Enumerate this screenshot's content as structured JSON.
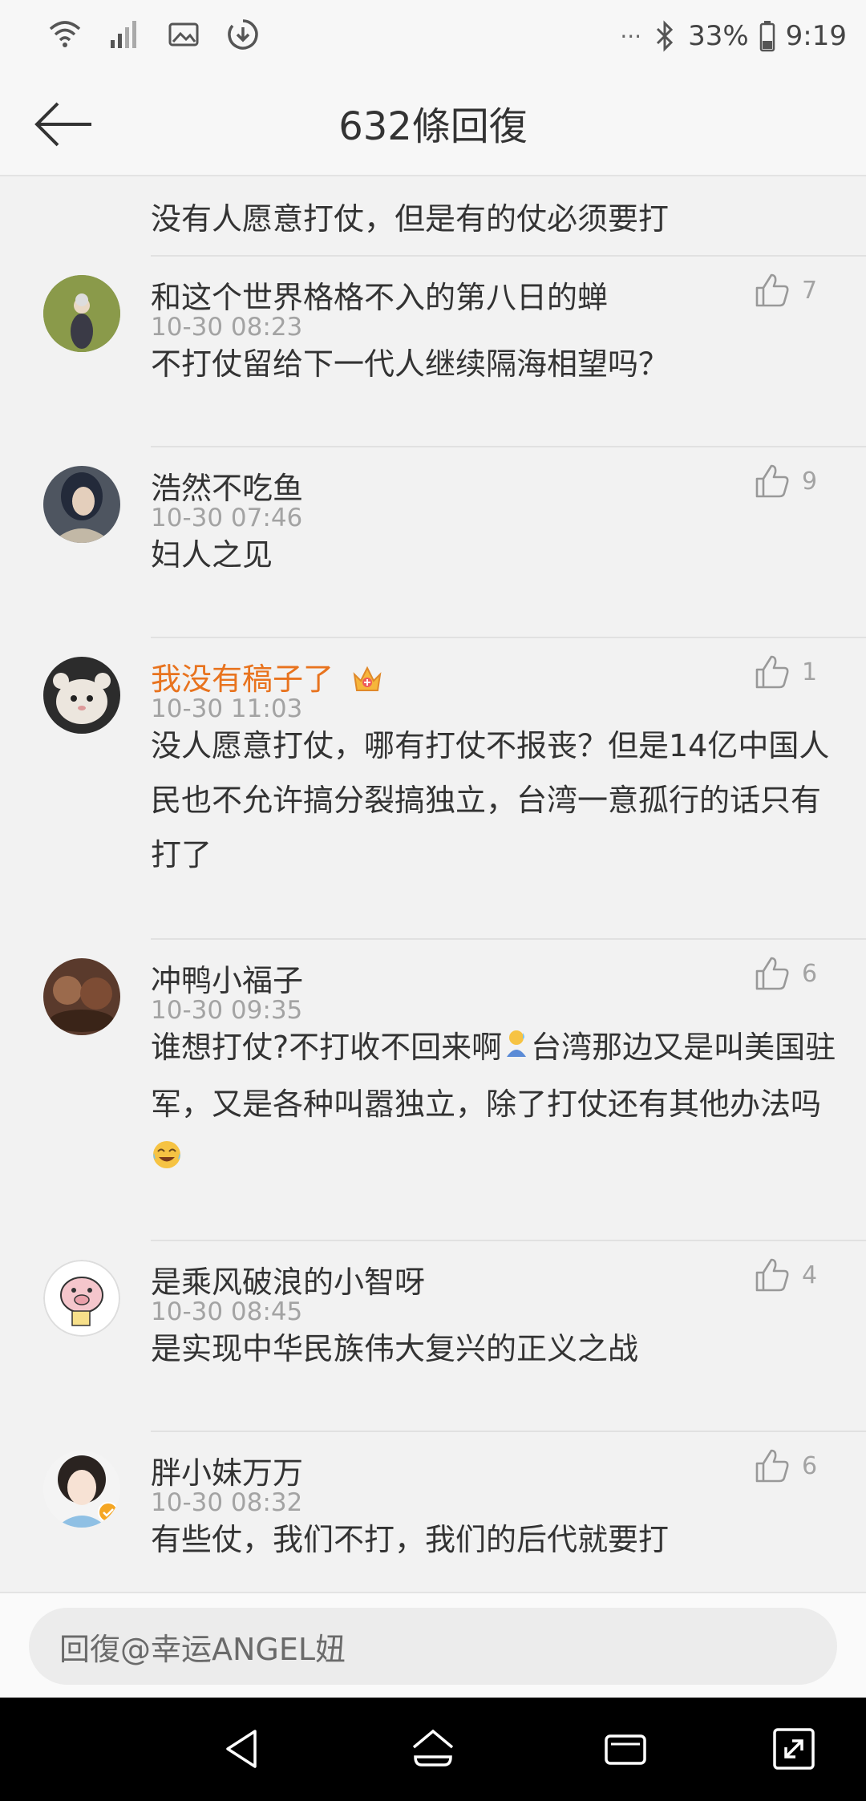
{
  "status_bar": {
    "battery": "33%",
    "time": "9:19",
    "more": "···",
    "icons": [
      "wifi-icon",
      "signal-icon",
      "image-icon",
      "download-icon",
      "bluetooth-icon",
      "battery-icon"
    ]
  },
  "header": {
    "title": "632條回復"
  },
  "thread": {
    "top_text": "没有人愿意打仗，但是有的仗必须要打",
    "comments": [
      {
        "name": "和这个世界格格不入的第八日的蝉",
        "time": "10-30 08:23",
        "likes": "7",
        "text": "不打仗留给下一代人继续隔海相望吗？"
      },
      {
        "name": "浩然不吃鱼",
        "time": "10-30 07:46",
        "likes": "9",
        "text": "妇人之见"
      },
      {
        "name": "我没有稿子了",
        "time": "10-30 11:03",
        "likes": "1",
        "text": "没人愿意打仗，哪有打仗不报丧？但是14亿中国人民也不允许搞分裂搞独立，台湾一意孤行的话只有打了"
      },
      {
        "name": "冲鸭小福子",
        "time": "10-30 09:35",
        "likes": "6",
        "text_part1": "谁想打仗?不打收不回来啊",
        "text_part2": "台湾那边又是叫美国驻军，又是各种叫嚣独立，除了打仗还有其他办法吗"
      },
      {
        "name": "是乘风破浪的小智呀",
        "time": "10-30 08:45",
        "likes": "4",
        "text": "是实现中华民族伟大复兴的正义之战"
      },
      {
        "name": "胖小妹万万",
        "time": "10-30 08:32",
        "likes": "6",
        "text": "有些仗，我们不打，我们的后代就要打"
      }
    ]
  },
  "reply": {
    "placeholder": "回復@幸运ANGEL妞"
  },
  "colors": {
    "vip_name": "#e8731e",
    "meta": "#a3a3a3",
    "text": "#333333"
  }
}
